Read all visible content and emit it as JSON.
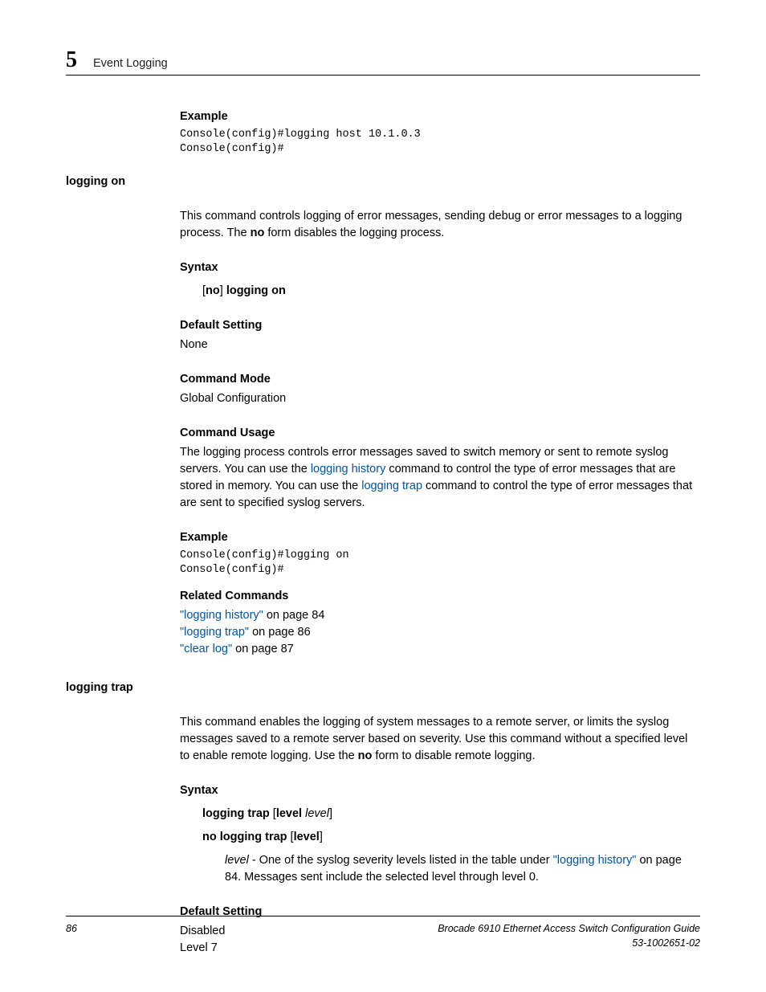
{
  "header": {
    "chapter_number": "5",
    "chapter_title": "Event Logging"
  },
  "content": {
    "example1": {
      "heading": "Example",
      "code": "Console(config)#logging host 10.1.0.3\nConsole(config)#"
    },
    "logging_on": {
      "side": "logging on",
      "intro_part1": "This command controls logging of error messages, sending debug or error messages to a logging process. The ",
      "intro_no": "no",
      "intro_part2": " form disables the logging process.",
      "syntax": {
        "heading": "Syntax",
        "line_bracket_open": "[",
        "line_no": "no",
        "line_bracket_close": "] ",
        "line_cmd": "logging on"
      },
      "default": {
        "heading": "Default Setting",
        "value": "None"
      },
      "mode": {
        "heading": "Command Mode",
        "value": "Global Configuration"
      },
      "usage": {
        "heading": "Command Usage",
        "p1": "The logging process controls error messages saved to switch memory or sent to remote syslog servers. You can use the ",
        "link1": "logging history",
        "p2": " command to control the type of error messages that are stored in memory. You can use the ",
        "link2": "logging trap",
        "p3": " command to control the type of error messages that are sent to specified syslog servers."
      },
      "example": {
        "heading": "Example",
        "code": "Console(config)#logging on\nConsole(config)#"
      },
      "related": {
        "heading": "Related Commands",
        "r1_link": "\"logging history\"",
        "r1_text": " on page 84",
        "r2_link": "\"logging trap\"",
        "r2_text": " on page 86",
        "r3_link": "\"clear log\"",
        "r3_text": " on page 87"
      }
    },
    "logging_trap": {
      "side": "logging trap",
      "intro_p1": "This command enables the logging of system messages to a remote server, or limits the syslog messages saved to a remote server based on severity. Use this command without a specified level to enable remote logging. Use the ",
      "intro_no": "no",
      "intro_p2": " form to disable remote logging.",
      "syntax": {
        "heading": "Syntax",
        "l1_cmd": "logging trap",
        "l1_b1": " [",
        "l1_level": "level",
        "l1_sp": " ",
        "l1_italic": "level",
        "l1_b2": "]",
        "l2_cmd": "no logging trap",
        "l2_b1": " [",
        "l2_level": "level",
        "l2_b2": "]",
        "desc_italic": "level",
        "desc_p1": " - One of the syslog severity levels listed in the table under ",
        "desc_link": "\"logging history\"",
        "desc_p2": " on page 84. Messages sent include the selected level through level 0."
      },
      "default": {
        "heading": "Default Setting",
        "v1": "Disabled",
        "v2": "Level 7"
      }
    }
  },
  "footer": {
    "page": "86",
    "title": "Brocade 6910 Ethernet Access Switch Configuration Guide",
    "docnum": "53-1002651-02"
  }
}
